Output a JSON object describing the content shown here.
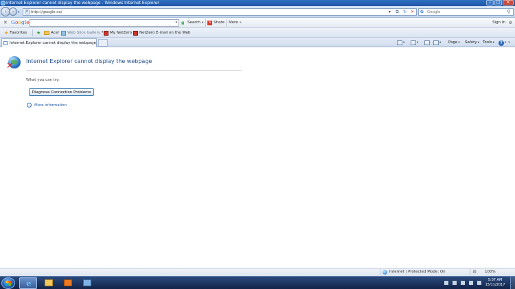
{
  "window": {
    "title": "Internet Explorer cannot display the webpage - Windows Internet Explorer"
  },
  "navigation": {
    "address_value": "http://google.ca/",
    "search_placeholder": "Google"
  },
  "google_toolbar": {
    "logo": "Google",
    "search_label": "Search",
    "share_label": "Share",
    "more_label": "More",
    "more_glyph": "»",
    "sign_in_label": "Sign In"
  },
  "favorites_bar": {
    "favorites_label": "Favorites",
    "items": [
      {
        "label": "Acer"
      },
      {
        "label": "Web Slice Gallery"
      },
      {
        "label": "My NetZero"
      },
      {
        "label": "NetZero E-mail on the Web"
      }
    ]
  },
  "tabs": [
    {
      "label": "Internet Explorer cannot display the webpage"
    }
  ],
  "command_bar": {
    "page_label": "Page",
    "safety_label": "Safety",
    "tools_label": "Tools"
  },
  "content": {
    "title": "Internet Explorer cannot display the webpage",
    "try_text": "What you can try:",
    "diagnose_button": "Diagnose Connection Problems",
    "more_info": "More information"
  },
  "status_bar": {
    "zone_text": "Internet | Protected Mode: On",
    "zoom": "100%"
  },
  "taskbar": {
    "time": "5:07 AM",
    "date": "15/11/2017"
  },
  "colors": {
    "title_link_blue": "#1f4e8c",
    "taskbar": "#12254a",
    "error_red": "#d32f2f"
  }
}
